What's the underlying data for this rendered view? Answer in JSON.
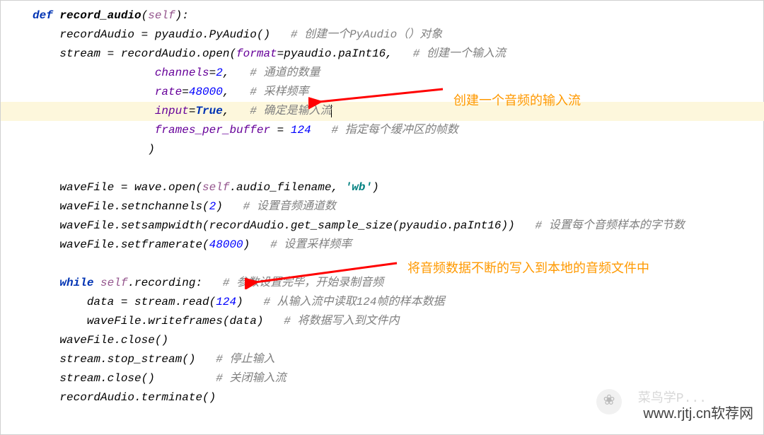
{
  "code": {
    "l1_def": "def",
    "l1_name": " record_audio",
    "l1_rest": "(",
    "l1_self": "self",
    "l1_close": "):",
    "l2_a": "    recordAudio = pyaudio.PyAudio()   ",
    "l2_c": "# 创建一个PyAudio（）对象",
    "l3_a": "    stream = recordAudio.open(",
    "l3_p": "format",
    "l3_b": "=pyaudio.paInt16,   ",
    "l3_c": "# 创建一个输入流",
    "l4_p": "channels",
    "l4_eq": "=",
    "l4_n": "2",
    "l4_b": ",   ",
    "l4_c": "# 通道的数量",
    "l5_p": "rate",
    "l5_eq": "=",
    "l5_n": "48000",
    "l5_b": ",   ",
    "l5_c": "# 采样频率",
    "l6_p": "input",
    "l6_eq": "=",
    "l6_t": "True",
    "l6_b": ",   ",
    "l6_c": "# 确定是输入流",
    "l7_p": "frames_per_buffer ",
    "l7_eq": "= ",
    "l7_n": "124",
    "l7_b": "   ",
    "l7_c": "# 指定每个缓冲区的帧数",
    "l8": "                 )",
    "l9_a": "    waveFile = wave.open(",
    "l9_self": "self",
    "l9_b": ".audio_filename, ",
    "l9_s": "'wb'",
    "l9_c": ")",
    "l10_a": "    waveFile.setnchannels(",
    "l10_n": "2",
    "l10_b": ")   ",
    "l10_c": "# 设置音频通道数",
    "l11_a": "    waveFile.setsampwidth(recordAudio.get_sample_size(pyaudio.paInt16))   ",
    "l11_c": "# 设置每个音频样本的字节数",
    "l12_a": "    waveFile.setframerate(",
    "l12_n": "48000",
    "l12_b": ")   ",
    "l12_c": "# 设置采样频率",
    "l13_kw": "while",
    "l13_sp": " ",
    "l13_self": "self",
    "l13_b": ".recording:   ",
    "l13_c": "# 参数设置完毕，开始录制音频",
    "l14_a": "        data = stream.read(",
    "l14_n": "124",
    "l14_b": ")   ",
    "l14_c": "# 从输入流中读取124帧的样本数据",
    "l15_a": "        waveFile.writeframes(data)   ",
    "l15_c": "# 将数据写入到文件内",
    "l16": "    waveFile.close()",
    "l17_a": "    stream.stop_stream()   ",
    "l17_c": "# 停止输入",
    "l18_a": "    stream.close()         ",
    "l18_c": "# 关闭输入流",
    "l19": "    recordAudio.terminate()"
  },
  "annot1": "创建一个音频的输入流",
  "annot2": "将音频数据不断的写入到本地的音频文件中",
  "watermark": "www.rjtj.cn软荐网",
  "wm2": "菜鸟学P..."
}
